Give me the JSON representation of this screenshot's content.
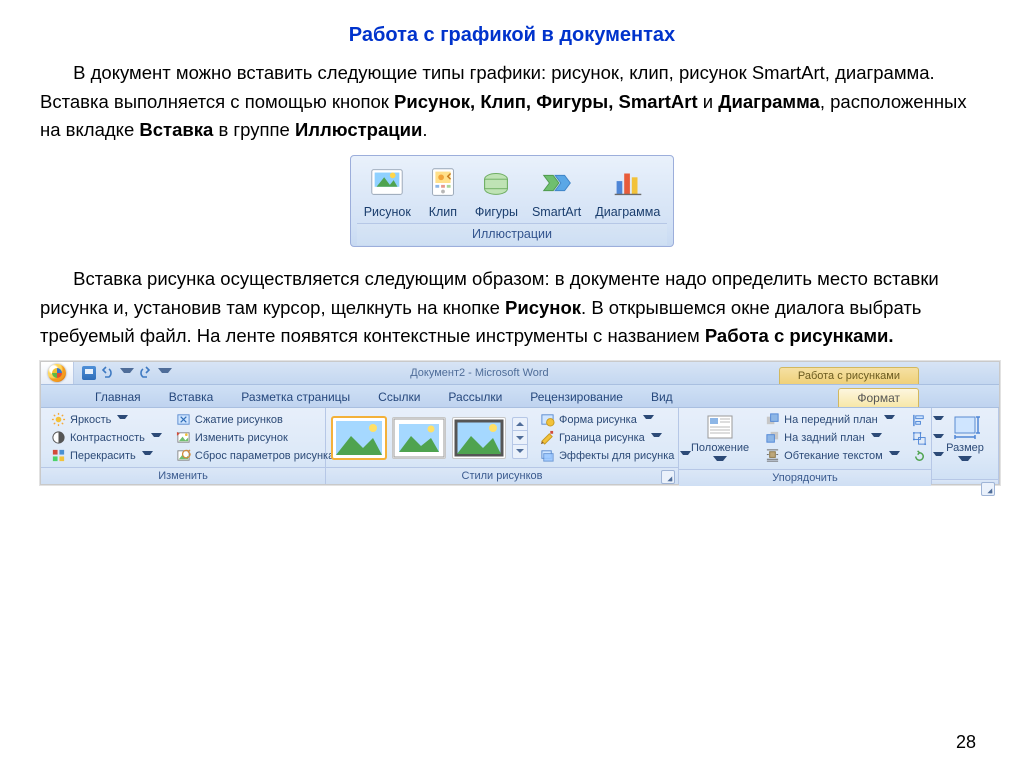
{
  "title": "Работа с графикой в документах",
  "para1_pre": "В документ можно вставить следующие типы графики",
  "para1_mid1": ": рисунок, клип, рисунок SmartArt, диаграмма. Вставка выполняется с помощью кнопок ",
  "para1_b1": "Рисунок, Клип, Фигуры, SmartArt",
  "para1_mid2": " и ",
  "para1_b2": "Диаграмма",
  "para1_mid3": ", расположенных на вкладке ",
  "para1_b3": "Вставка",
  "para1_mid4": " в группе ",
  "para1_b4": "Иллюстрации",
  "para1_end": ".",
  "illus": {
    "items": [
      "Рисунок",
      "Клип",
      "Фигуры",
      "SmartArt",
      "Диаграмма"
    ],
    "caption": "Иллюстрации"
  },
  "para2_pre": "Вставка рисунка осуществляется следующим образом: в документе надо определить место вставки рисунка и, установив там курсор, щелкнуть на кнопке ",
  "para2_b1": "Рисунок",
  "para2_mid": ". В открывшемся окне диалога выбрать требуемый файл. На ленте появятся контекстные инструменты с названием ",
  "para2_b2": "Работа с рисунками.",
  "ribbon": {
    "doc_title": "Документ2 - Microsoft Word",
    "context_title": "Работа с рисунками",
    "tabs": [
      "Главная",
      "Вставка",
      "Разметка страницы",
      "Ссылки",
      "Рассылки",
      "Рецензирование",
      "Вид"
    ],
    "active_tab": "Формат",
    "g_change": {
      "cap": "Изменить",
      "brightness": "Яркость",
      "contrast": "Контрастность",
      "recolor": "Перекрасить",
      "compress": "Сжатие рисунков",
      "change": "Изменить рисунок",
      "reset": "Сброс параметров рисунка"
    },
    "g_styles": {
      "cap": "Стили рисунков",
      "shape": "Форма рисунка",
      "border": "Граница рисунка",
      "effects": "Эффекты для рисунка"
    },
    "g_arrange": {
      "cap": "Упорядочить",
      "position": "Положение",
      "front": "На передний план",
      "back": "На задний план",
      "wrap": "Обтекание текстом"
    },
    "g_size": {
      "cap": "",
      "size": "Размер"
    }
  },
  "page_number": "28"
}
